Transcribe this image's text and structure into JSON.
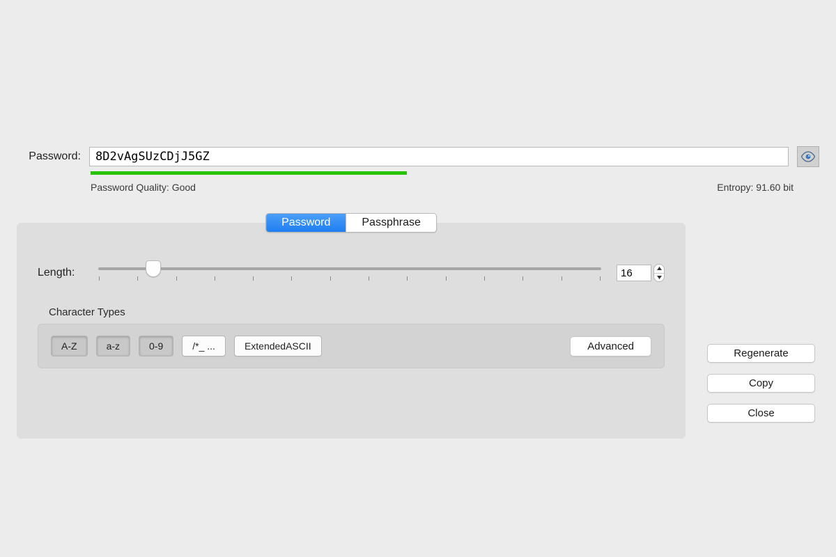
{
  "password": {
    "label": "Password:",
    "value": "8D2vAgSUzCDjJ5GZ"
  },
  "strength": {
    "quality_label": "Password Quality: Good",
    "entropy_label": "Entropy: 91.60 bit",
    "fill_percent": 45,
    "fill_color": "#27c300"
  },
  "tabs": {
    "password": "Password",
    "passphrase": "Passphrase",
    "active": "password"
  },
  "length": {
    "label": "Length:",
    "value": "16",
    "min": 1,
    "max": 128,
    "ticks": 14,
    "thumb_percent": 11
  },
  "char_types": {
    "group_label": "Character Types",
    "upper": "A-Z",
    "lower": "a-z",
    "digits": "0-9",
    "symbols": "/*_ ...",
    "extascii": "ExtendedASCII",
    "advanced": "Advanced"
  },
  "actions": {
    "regenerate": "Regenerate",
    "copy": "Copy",
    "close": "Close"
  }
}
